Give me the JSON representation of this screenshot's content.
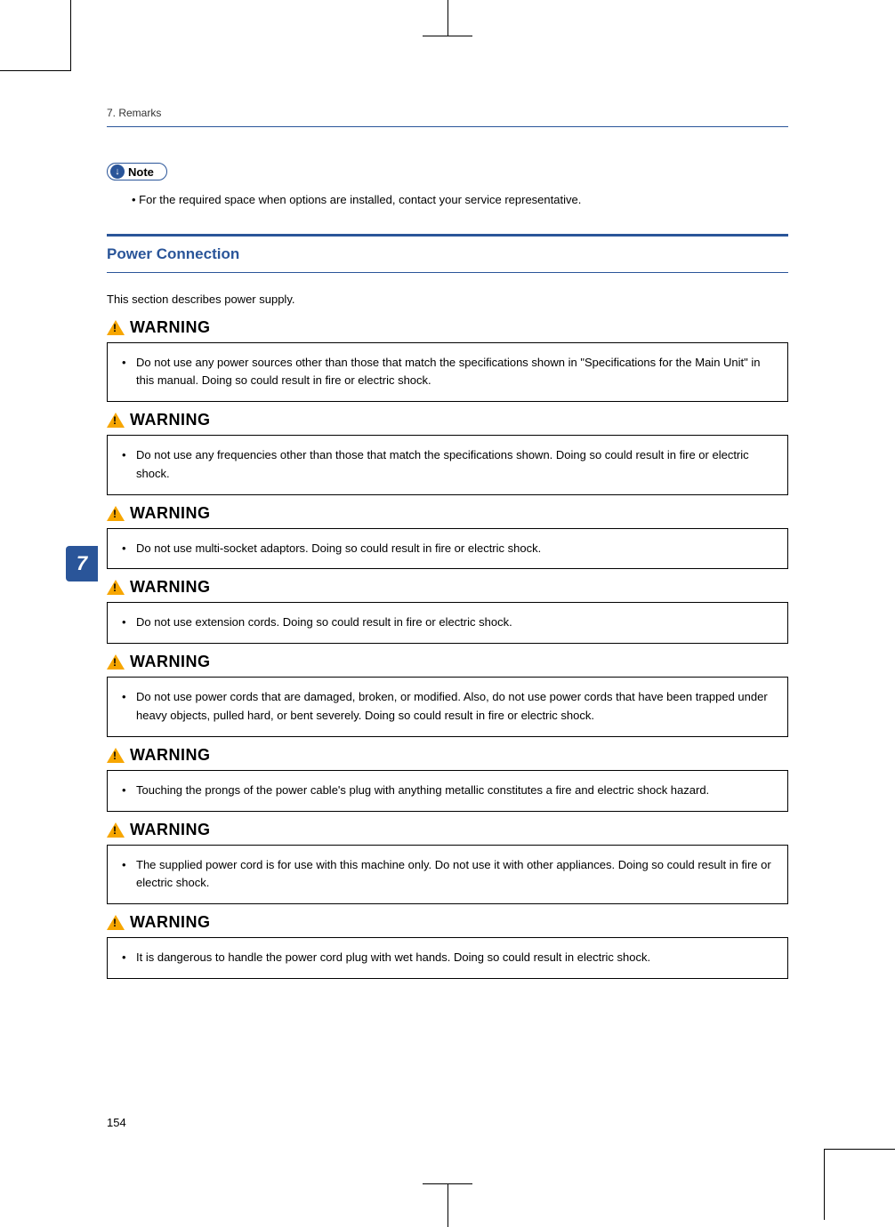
{
  "header": {
    "breadcrumb": "7. Remarks"
  },
  "chapter_tab": "7",
  "note": {
    "label": "Note",
    "bullet": "For the required space when options are installed, contact your service representative."
  },
  "section": {
    "title": "Power Connection",
    "intro": "This section describes power supply."
  },
  "warning_label": "WARNING",
  "warnings": [
    "Do not use any power sources other than those that match the specifications shown in \"Specifications for the Main Unit\" in this manual. Doing so could result in fire or electric shock.",
    "Do not use any frequencies other than those that match the specifications shown. Doing so could result in fire or electric shock.",
    "Do not use multi-socket adaptors. Doing so could result in fire or electric shock.",
    "Do not use extension cords. Doing so could result in fire or electric shock.",
    "Do not use power cords that are damaged, broken, or modified. Also, do not use power cords that have been trapped under heavy objects, pulled hard, or bent severely. Doing so could result in fire or electric shock.",
    "Touching the prongs of the power cable's plug with anything metallic constitutes a fire and electric shock hazard.",
    "The supplied power cord is for use with this machine only. Do not use it with other appliances. Doing so could result in fire or electric shock.",
    "It is dangerous to handle the power cord plug with wet hands. Doing so could result in electric shock."
  ],
  "page_number": "154"
}
